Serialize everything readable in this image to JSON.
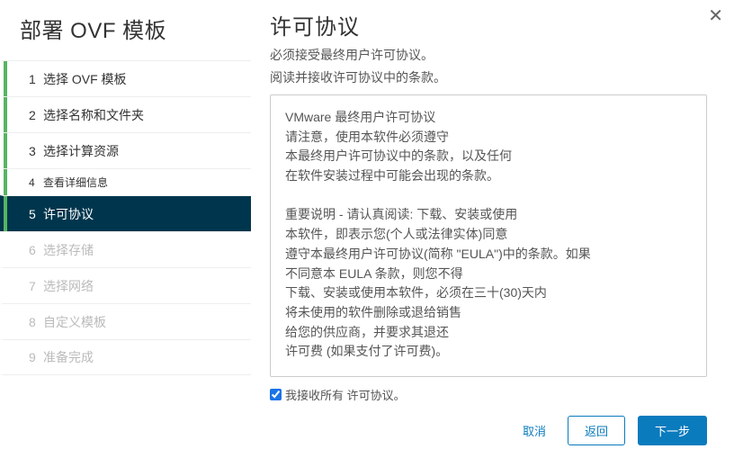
{
  "dialog": {
    "title": "部署 OVF 模板"
  },
  "steps": [
    {
      "num": "1",
      "label": "选择 OVF 模板",
      "state": "done"
    },
    {
      "num": "2",
      "label": "选择名称和文件夹",
      "state": "done"
    },
    {
      "num": "3",
      "label": "选择计算资源",
      "state": "done"
    },
    {
      "num": "4",
      "label": "查看详细信息",
      "state": "small"
    },
    {
      "num": "5",
      "label": "许可协议",
      "state": "active"
    },
    {
      "num": "6",
      "label": "选择存储",
      "state": "disabled"
    },
    {
      "num": "7",
      "label": "选择网络",
      "state": "disabled"
    },
    {
      "num": "8",
      "label": "自定义模板",
      "state": "disabled"
    },
    {
      "num": "9",
      "label": "准备完成",
      "state": "disabled"
    }
  ],
  "main": {
    "heading": "许可协议",
    "subtitle1": "必须接受最终用户许可协议。",
    "subtitle2": "阅读并接收许可协议中的条款。",
    "eula_text": "VMware 最终用户许可协议\n请注意，使用本软件必须遵守\n本最终用户许可协议中的条款，以及任何\n在软件安装过程中可能会出现的条款。\n\n重要说明 - 请认真阅读:  下载、安装或使用\n本软件，即表示您(个人或法律实体)同意\n遵守本最终用户许可协议(简称 \"EULA\")中的条款。如果\n不同意本 EULA 条款，则您不得\n下载、安装或使用本软件，必须在三十(30)天内\n将未使用的软件删除或退给销售\n给您的供应商，并要求其退还\n许可费 (如果支付了许可费)。",
    "accept_label": "我接收所有 许可协议。",
    "accept_checked": true
  },
  "footer": {
    "cancel": "取消",
    "back": "返回",
    "next": "下一步"
  },
  "icons": {
    "close": "✕"
  }
}
